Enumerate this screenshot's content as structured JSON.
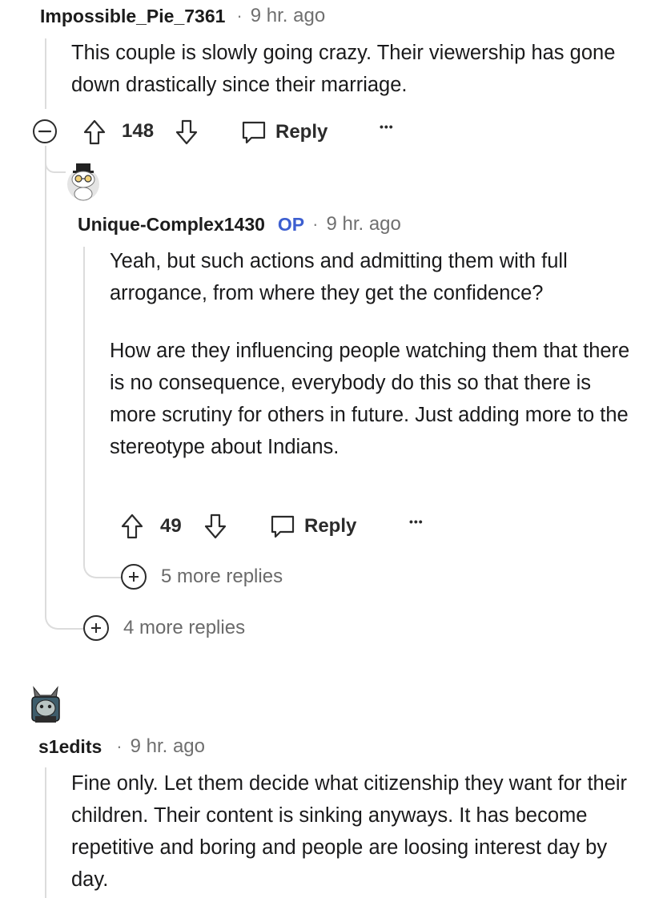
{
  "comment1": {
    "username": "Impossible_Pie_7361",
    "separator": "·",
    "time": "9 hr. ago",
    "body": "This couple is slowly going crazy. Their viewership has gone down drastically since their marriage.",
    "votes": "148",
    "reply_label": "Reply",
    "more_label": "•••"
  },
  "comment2": {
    "username": "Unique-Complex1430",
    "op_badge": "OP",
    "separator": "·",
    "time": "9 hr. ago",
    "body_p1": "Yeah, but such actions and admitting them with full arrogance, from where they get the confidence?",
    "body_p2": "How are they influencing people watching them that there is no consequence, everybody do this so that there is more scrutiny for others in future. Just adding more to the stereotype about Indians.",
    "votes": "49",
    "reply_label": "Reply",
    "more_label": "•••",
    "more_replies": "5 more replies"
  },
  "thread1_more_replies": "4 more replies",
  "comment3": {
    "username": "s1edits",
    "separator": "·",
    "time": "9 hr. ago",
    "body": "Fine only. Let them decide what citizenship they want for their children. Their content is sinking anyways. It has become repetitive and boring and people are loosing interest day by day."
  },
  "colors": {
    "op": "#3d5fd0",
    "thread_line": "#dcdcdc",
    "meta_text": "#6f6f6f"
  }
}
